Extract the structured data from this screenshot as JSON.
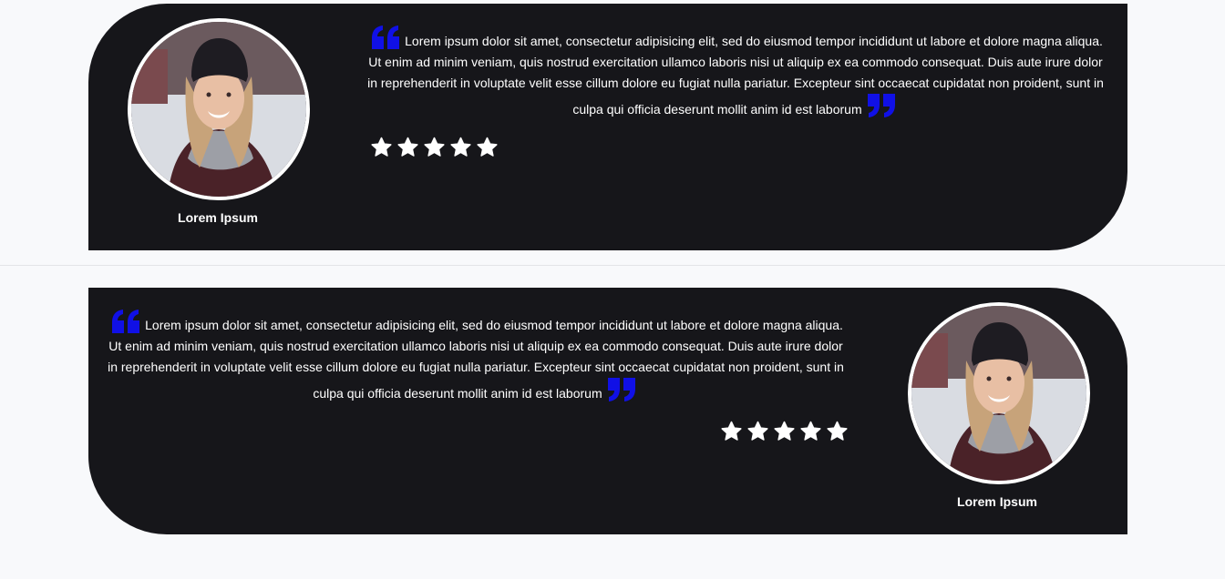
{
  "testimonials": [
    {
      "name": "Lorem Ipsum",
      "text": "Lorem ipsum dolor sit amet, consectetur adipisicing elit, sed do eiusmod tempor incididunt ut labore et dolore magna aliqua. Ut enim ad minim veniam, quis nostrud exercitation ullamco laboris nisi ut aliquip ex ea commodo consequat. Duis aute irure dolor in reprehenderit in voluptate velit esse cillum dolore eu fugiat nulla pariatur. Excepteur sint occaecat cupidatat non proident, sunt in culpa qui officia deserunt mollit anim id est laborum",
      "rating": 5,
      "avatar_icon": "user-photo"
    },
    {
      "name": "Lorem Ipsum",
      "text": "Lorem ipsum dolor sit amet, consectetur adipisicing elit, sed do eiusmod tempor incididunt ut labore et dolore magna aliqua. Ut enim ad minim veniam, quis nostrud exercitation ullamco laboris nisi ut aliquip ex ea commodo consequat. Duis aute irure dolor in reprehenderit in voluptate velit esse cillum dolore eu fugiat nulla pariatur. Excepteur sint occaecat cupidatat non proident, sunt in culpa qui officia deserunt mollit anim id est laborum",
      "rating": 5,
      "avatar_icon": "user-photo"
    }
  ],
  "colors": {
    "card_background": "#16161a",
    "page_background": "#f8f9fb",
    "quote_accent": "#1010e6",
    "text": "#ffffff"
  }
}
